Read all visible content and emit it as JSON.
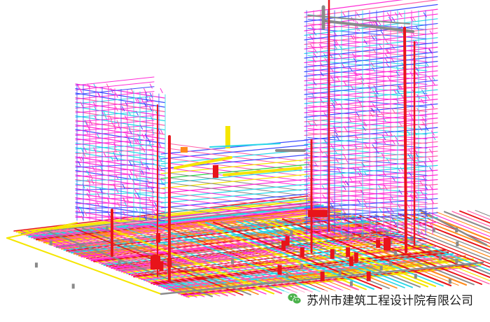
{
  "watermark": {
    "icon": "wechat-icon",
    "text": "苏州市建筑工程设计院有限公司"
  },
  "colors": {
    "background": "#ffffff",
    "magenta_pipe": "#ff2bd6",
    "pink_pipe": "#ff5fa8",
    "cyan_pipe": "#29d7e8",
    "blue_pipe": "#3d4cff",
    "yellow_pipe": "#f5e600",
    "red_pipe": "#e8141a",
    "green_pipe": "#2bd84a",
    "orange_pipe": "#ff8a1a",
    "gray_pipe": "#8a8a8a"
  }
}
